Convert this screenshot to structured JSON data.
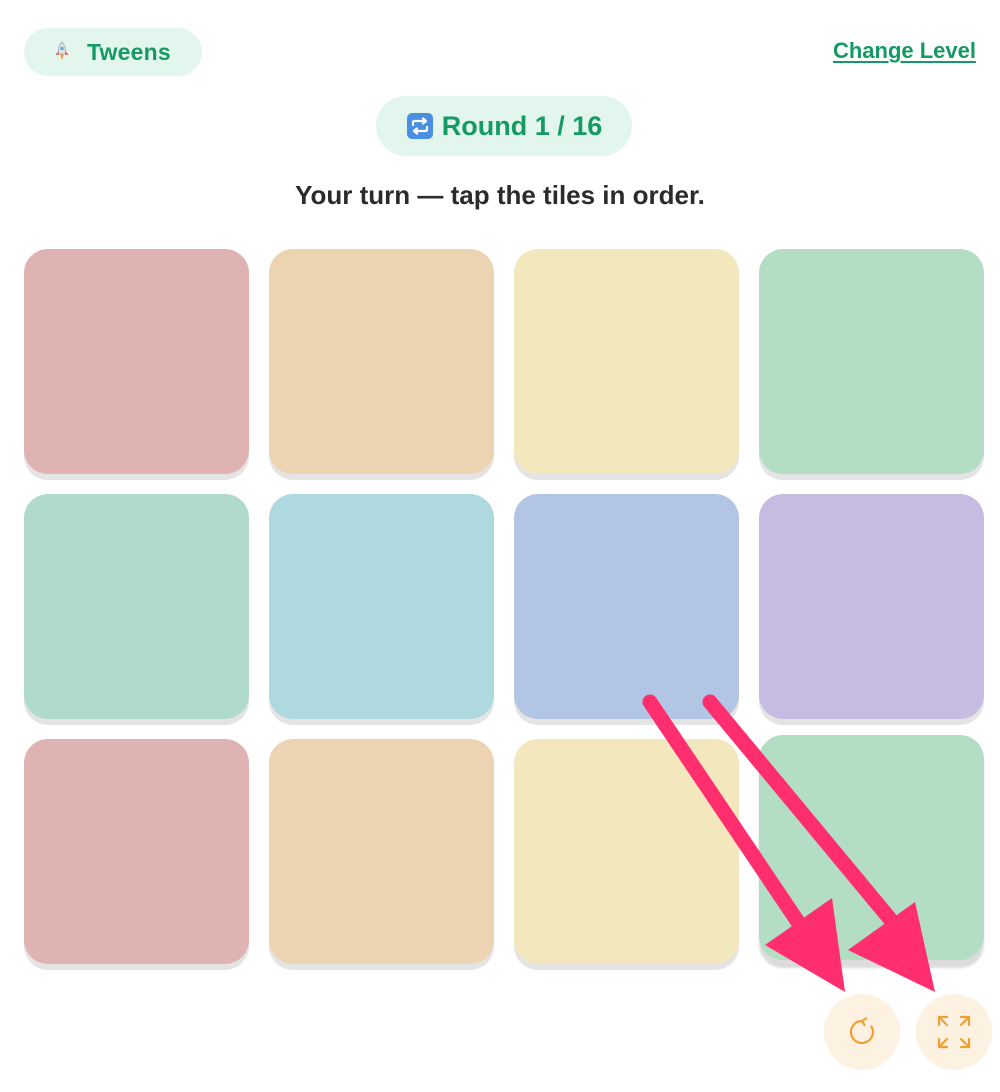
{
  "header": {
    "level_label": "Tweens",
    "level_icon": "rocket-icon",
    "change_level_label": "Change Level"
  },
  "round": {
    "icon": "repeat-icon",
    "label": "Round 1 / 16"
  },
  "instruction": "Your turn — tap the tiles in order.",
  "tiles": [
    {
      "color": "#e0b3b3"
    },
    {
      "color": "#ecd4b3"
    },
    {
      "color": "#f3e7bd"
    },
    {
      "color": "#b3dec4"
    },
    {
      "color": "#b0dacb"
    },
    {
      "color": "#aed9df"
    },
    {
      "color": "#b3c5e4"
    },
    {
      "color": "#c6bbe1"
    },
    {
      "color": "#e0b3b3"
    },
    {
      "color": "#ecd4b3"
    },
    {
      "color": "#f3e7bd"
    },
    {
      "color": "#b3dec4"
    }
  ],
  "controls": {
    "restart_icon": "restart-icon",
    "fullscreen_icon": "expand-icon",
    "icon_color": "#f0a030",
    "button_bg": "#fdf1e2"
  },
  "colors": {
    "accent": "#159a63",
    "pill_bg": "#e3f6ee",
    "annotation_arrow": "#ff2e6e"
  }
}
